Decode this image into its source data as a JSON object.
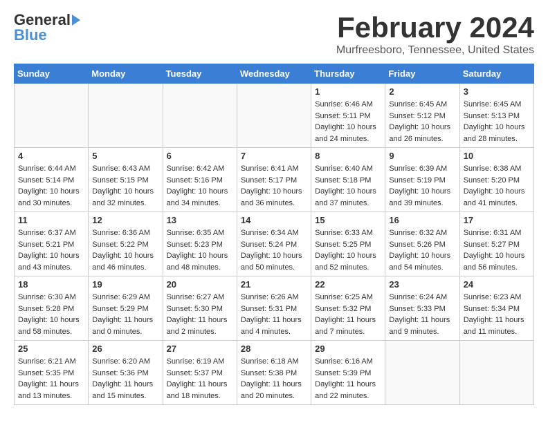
{
  "logo": {
    "general": "General",
    "blue": "Blue",
    "arrow": "▶"
  },
  "title": {
    "month_year": "February 2024",
    "location": "Murfreesboro, Tennessee, United States"
  },
  "headers": [
    "Sunday",
    "Monday",
    "Tuesday",
    "Wednesday",
    "Thursday",
    "Friday",
    "Saturday"
  ],
  "weeks": [
    [
      {
        "day": "",
        "info": ""
      },
      {
        "day": "",
        "info": ""
      },
      {
        "day": "",
        "info": ""
      },
      {
        "day": "",
        "info": ""
      },
      {
        "day": "1",
        "info": "Sunrise: 6:46 AM\nSunset: 5:11 PM\nDaylight: 10 hours\nand 24 minutes."
      },
      {
        "day": "2",
        "info": "Sunrise: 6:45 AM\nSunset: 5:12 PM\nDaylight: 10 hours\nand 26 minutes."
      },
      {
        "day": "3",
        "info": "Sunrise: 6:45 AM\nSunset: 5:13 PM\nDaylight: 10 hours\nand 28 minutes."
      }
    ],
    [
      {
        "day": "4",
        "info": "Sunrise: 6:44 AM\nSunset: 5:14 PM\nDaylight: 10 hours\nand 30 minutes."
      },
      {
        "day": "5",
        "info": "Sunrise: 6:43 AM\nSunset: 5:15 PM\nDaylight: 10 hours\nand 32 minutes."
      },
      {
        "day": "6",
        "info": "Sunrise: 6:42 AM\nSunset: 5:16 PM\nDaylight: 10 hours\nand 34 minutes."
      },
      {
        "day": "7",
        "info": "Sunrise: 6:41 AM\nSunset: 5:17 PM\nDaylight: 10 hours\nand 36 minutes."
      },
      {
        "day": "8",
        "info": "Sunrise: 6:40 AM\nSunset: 5:18 PM\nDaylight: 10 hours\nand 37 minutes."
      },
      {
        "day": "9",
        "info": "Sunrise: 6:39 AM\nSunset: 5:19 PM\nDaylight: 10 hours\nand 39 minutes."
      },
      {
        "day": "10",
        "info": "Sunrise: 6:38 AM\nSunset: 5:20 PM\nDaylight: 10 hours\nand 41 minutes."
      }
    ],
    [
      {
        "day": "11",
        "info": "Sunrise: 6:37 AM\nSunset: 5:21 PM\nDaylight: 10 hours\nand 43 minutes."
      },
      {
        "day": "12",
        "info": "Sunrise: 6:36 AM\nSunset: 5:22 PM\nDaylight: 10 hours\nand 46 minutes."
      },
      {
        "day": "13",
        "info": "Sunrise: 6:35 AM\nSunset: 5:23 PM\nDaylight: 10 hours\nand 48 minutes."
      },
      {
        "day": "14",
        "info": "Sunrise: 6:34 AM\nSunset: 5:24 PM\nDaylight: 10 hours\nand 50 minutes."
      },
      {
        "day": "15",
        "info": "Sunrise: 6:33 AM\nSunset: 5:25 PM\nDaylight: 10 hours\nand 52 minutes."
      },
      {
        "day": "16",
        "info": "Sunrise: 6:32 AM\nSunset: 5:26 PM\nDaylight: 10 hours\nand 54 minutes."
      },
      {
        "day": "17",
        "info": "Sunrise: 6:31 AM\nSunset: 5:27 PM\nDaylight: 10 hours\nand 56 minutes."
      }
    ],
    [
      {
        "day": "18",
        "info": "Sunrise: 6:30 AM\nSunset: 5:28 PM\nDaylight: 10 hours\nand 58 minutes."
      },
      {
        "day": "19",
        "info": "Sunrise: 6:29 AM\nSunset: 5:29 PM\nDaylight: 11 hours\nand 0 minutes."
      },
      {
        "day": "20",
        "info": "Sunrise: 6:27 AM\nSunset: 5:30 PM\nDaylight: 11 hours\nand 2 minutes."
      },
      {
        "day": "21",
        "info": "Sunrise: 6:26 AM\nSunset: 5:31 PM\nDaylight: 11 hours\nand 4 minutes."
      },
      {
        "day": "22",
        "info": "Sunrise: 6:25 AM\nSunset: 5:32 PM\nDaylight: 11 hours\nand 7 minutes."
      },
      {
        "day": "23",
        "info": "Sunrise: 6:24 AM\nSunset: 5:33 PM\nDaylight: 11 hours\nand 9 minutes."
      },
      {
        "day": "24",
        "info": "Sunrise: 6:23 AM\nSunset: 5:34 PM\nDaylight: 11 hours\nand 11 minutes."
      }
    ],
    [
      {
        "day": "25",
        "info": "Sunrise: 6:21 AM\nSunset: 5:35 PM\nDaylight: 11 hours\nand 13 minutes."
      },
      {
        "day": "26",
        "info": "Sunrise: 6:20 AM\nSunset: 5:36 PM\nDaylight: 11 hours\nand 15 minutes."
      },
      {
        "day": "27",
        "info": "Sunrise: 6:19 AM\nSunset: 5:37 PM\nDaylight: 11 hours\nand 18 minutes."
      },
      {
        "day": "28",
        "info": "Sunrise: 6:18 AM\nSunset: 5:38 PM\nDaylight: 11 hours\nand 20 minutes."
      },
      {
        "day": "29",
        "info": "Sunrise: 6:16 AM\nSunset: 5:39 PM\nDaylight: 11 hours\nand 22 minutes."
      },
      {
        "day": "",
        "info": ""
      },
      {
        "day": "",
        "info": ""
      }
    ]
  ]
}
